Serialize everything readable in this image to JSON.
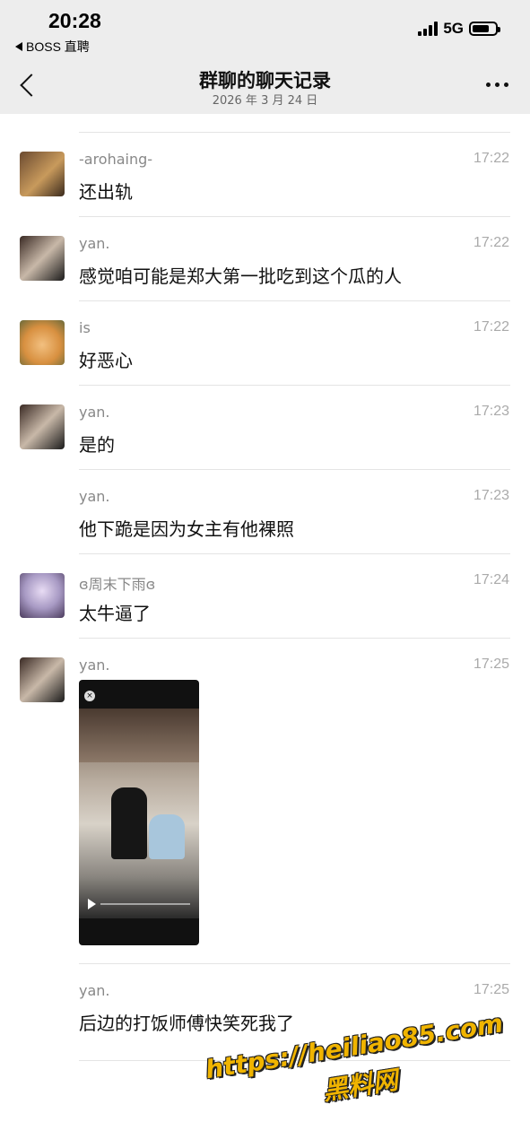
{
  "status": {
    "time": "20:28",
    "back_app": "BOSS 直聘",
    "network": "5G",
    "battery_level": 0.75
  },
  "nav": {
    "title": "群聊的聊天记录",
    "date": "2026 年 3 月 24 日"
  },
  "messages": [
    {
      "sender": "-arohaing-",
      "time": "17:22",
      "text": "还出轨",
      "avatar": "cat-avatar"
    },
    {
      "sender": "yan.",
      "time": "17:22",
      "text": "感觉咱可能是郑大第一批吃到这个瓜的人",
      "avatar": "girl-avatar"
    },
    {
      "sender": "is",
      "time": "17:22",
      "text": "好恶心",
      "avatar": "orange-cat-avatar"
    },
    {
      "sender": "yan.",
      "time": "17:23",
      "text": "是的",
      "avatar": "girl-avatar"
    },
    {
      "sender": "yan.",
      "time": "17:23",
      "text": "他下跪是因为女主有他裸照",
      "avatar": ""
    },
    {
      "sender": "ɞ周末下雨ɞ",
      "time": "17:24",
      "text": "太牛逼了",
      "avatar": "anime-avatar"
    },
    {
      "sender": "yan.",
      "time": "17:25",
      "text": "",
      "avatar": "girl-avatar",
      "video": true
    },
    {
      "sender": "yan.",
      "time": "17:25",
      "text": "后边的打饭师傅快笑死我了",
      "avatar": ""
    }
  ],
  "watermark": {
    "line1": "https://heiliao85.com",
    "line2": "黑料网"
  }
}
